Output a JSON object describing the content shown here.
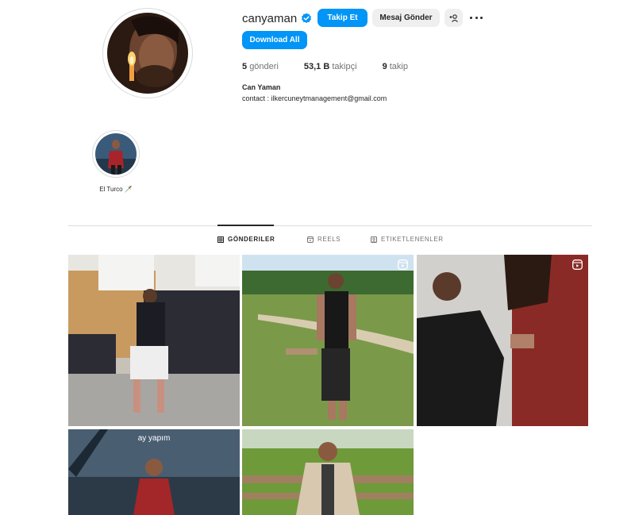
{
  "profile": {
    "username": "canyaman",
    "follow_label": "Takip Et",
    "message_label": "Mesaj Gönder",
    "download_label": "Download All",
    "full_name": "Can Yaman",
    "bio": "contact : ilkercuneytmanagement@gmail.com",
    "stats": [
      {
        "value": "5",
        "label": "gönderi"
      },
      {
        "value": "53,1 B",
        "label": "takipçi"
      },
      {
        "value": "9",
        "label": "takip"
      }
    ]
  },
  "highlights": [
    {
      "label": "El Turco 🗡️"
    }
  ],
  "tabs": [
    {
      "label": "GÖNDERILER",
      "active": true
    },
    {
      "label": "REELS",
      "active": false
    },
    {
      "label": "ETIKETLENENLER",
      "active": false
    }
  ],
  "posts": [
    {
      "type": "reel-icon",
      "alt": "gym"
    },
    {
      "type": "reel-icon",
      "alt": "field"
    },
    {
      "type": "reel-icon",
      "alt": "costume"
    },
    {
      "type": "image",
      "alt": "ay yapim"
    },
    {
      "type": "image",
      "alt": "bench"
    }
  ],
  "post4_caption": "ay yapım",
  "colors": {
    "accent": "#0095f6",
    "verified": "#0095f6"
  }
}
